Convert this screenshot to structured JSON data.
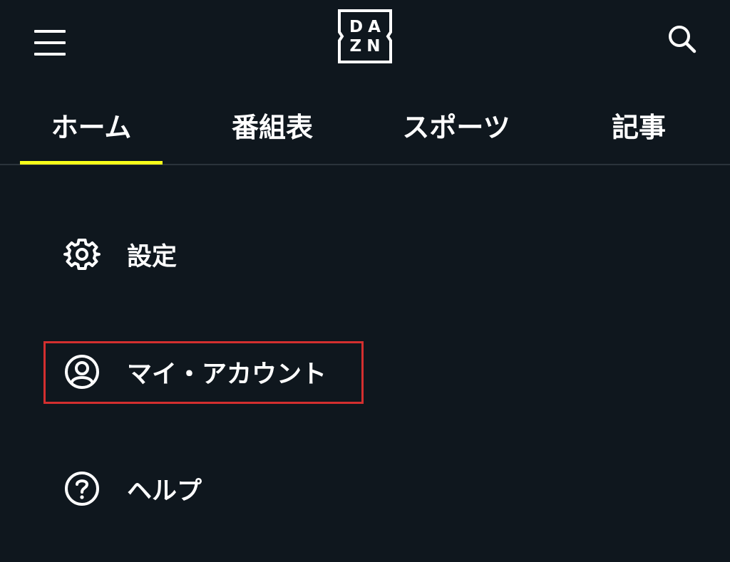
{
  "app": {
    "logo_line1": "DA",
    "logo_line2": "ZN"
  },
  "header": {
    "menu_icon": "hamburger-menu-icon",
    "search_icon": "search-icon"
  },
  "tabs": [
    {
      "label": "ホーム",
      "active": true
    },
    {
      "label": "番組表",
      "active": false
    },
    {
      "label": "スポーツ",
      "active": false
    },
    {
      "label": "記事",
      "active": false
    }
  ],
  "menu": {
    "items": [
      {
        "label": "設定",
        "icon": "gear-icon"
      },
      {
        "label": "マイ・アカウント",
        "icon": "user-circle-icon",
        "highlighted": true
      },
      {
        "label": "ヘルプ",
        "icon": "help-circle-icon"
      }
    ]
  },
  "colors": {
    "background": "#0f171e",
    "accent": "#f7ff1a",
    "highlight_border": "#d32f2f",
    "text": "#ffffff"
  }
}
